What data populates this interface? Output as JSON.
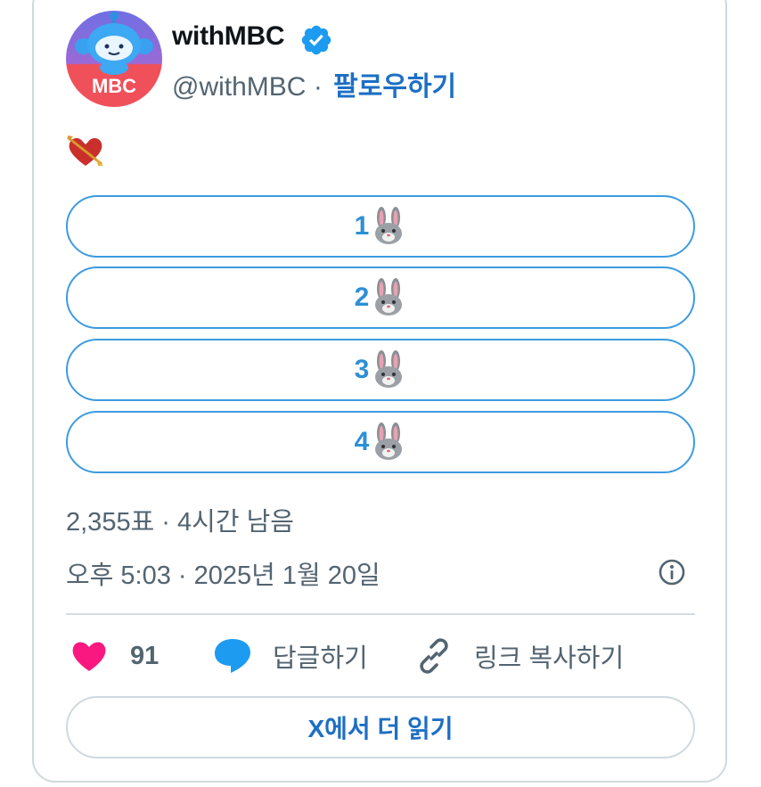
{
  "author": {
    "display_name": "withMBC",
    "handle": "@withMBC",
    "separator": "·",
    "follow_label": "팔로우하기",
    "avatar_text": "MBC",
    "verified_color": "#1d9bf0"
  },
  "tweet": {
    "emoji": "heart-with-arrow"
  },
  "poll": {
    "options": [
      {
        "label": "1",
        "emoji": "rabbit-face"
      },
      {
        "label": "2",
        "emoji": "rabbit-face"
      },
      {
        "label": "3",
        "emoji": "rabbit-face"
      },
      {
        "label": "4",
        "emoji": "rabbit-face"
      }
    ],
    "stats": "2,355표 · 4시간 남음",
    "accent_color": "#3d9be0"
  },
  "timestamp": "오후 5:03 · 2025년 1월 20일",
  "actions": {
    "likes": "91",
    "reply_label": "답글하기",
    "copy_link_label": "링크 복사하기",
    "like_color": "#f91880",
    "reply_color": "#1d9bf0"
  },
  "read_more_label": "X에서 더 읽기"
}
